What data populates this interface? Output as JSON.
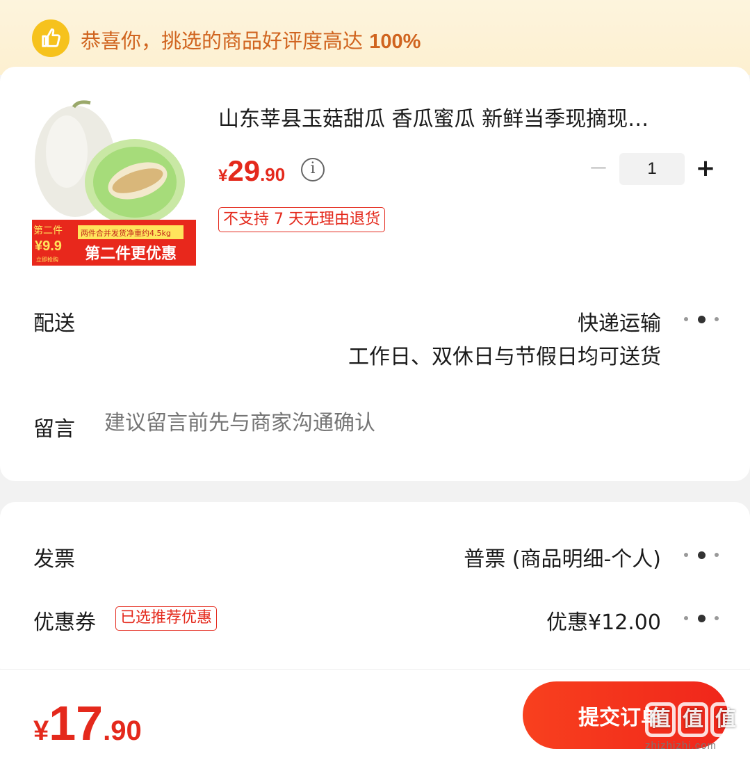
{
  "banner": {
    "prefix": "恭喜你，挑选的商品好评度高达 ",
    "rate": "100%"
  },
  "product": {
    "title": "山东莘县玉菇甜瓜  香瓜蜜瓜 新鲜当季现摘现…",
    "price_symbol": "¥",
    "price_int": "29",
    "price_dec": ".90",
    "quantity": "1",
    "return_policy": "不支持 7 天无理由退货",
    "image": {
      "promo_top": "第二件",
      "promo_price": "¥9.9",
      "promo_small": "立即抢购",
      "promo_weight": "两件合并发货净重约4.5kg",
      "promo_main": "第二件更优惠"
    }
  },
  "delivery": {
    "label": "配送",
    "method": "快递运输",
    "schedule": "工作日、双休日与节假日均可送货"
  },
  "message": {
    "label": "留言",
    "placeholder": "建议留言前先与商家沟通确认"
  },
  "invoice": {
    "label": "发票",
    "value": "普票 (商品明细-个人)"
  },
  "coupon": {
    "label": "优惠券",
    "tag": "已选推荐优惠",
    "value": "优惠¥12.00"
  },
  "footer": {
    "symbol": "¥",
    "total_int": "17",
    "total_dec": ".90",
    "submit_label": "提交订单"
  },
  "watermark": {
    "logo": [
      "值",
      "值",
      "值"
    ],
    "url": "zhizhizhi.com"
  },
  "icons": {
    "banner": "thumbs-up-icon",
    "info": "info-icon",
    "more": "more-dots-icon"
  },
  "colors": {
    "accent": "#e4291c",
    "banner_bg": "#fdf3da",
    "banner_text": "#d0641f",
    "thumb": "#f6c21d"
  }
}
